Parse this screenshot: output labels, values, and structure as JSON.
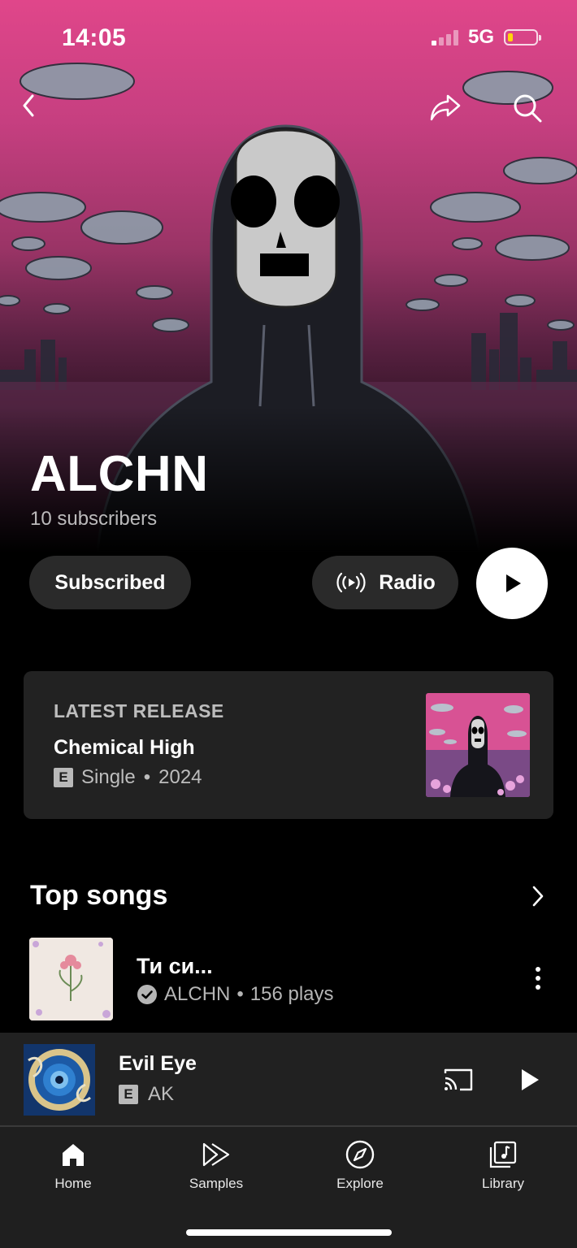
{
  "status_bar": {
    "time": "14:05",
    "network": "5G"
  },
  "artist": {
    "name": "ALCHN",
    "subscribers": "10 subscribers"
  },
  "actions": {
    "subscribe_label": "Subscribed",
    "radio_label": "Radio"
  },
  "latest_release": {
    "kicker": "LATEST RELEASE",
    "title": "Chemical High",
    "explicit_badge": "E",
    "type": "Single",
    "separator": "•",
    "year": "2024"
  },
  "top_songs": {
    "title": "Top songs",
    "items": [
      {
        "title": "Ти си...",
        "artist": "ALCHN",
        "separator": "•",
        "plays": "156 plays"
      }
    ]
  },
  "now_playing": {
    "title": "Evil Eye",
    "explicit_badge": "E",
    "artist": "AK"
  },
  "nav": {
    "items": [
      {
        "label": "Home",
        "icon": "home-icon"
      },
      {
        "label": "Samples",
        "icon": "samples-icon"
      },
      {
        "label": "Explore",
        "icon": "explore-icon"
      },
      {
        "label": "Library",
        "icon": "library-icon"
      }
    ]
  },
  "colors": {
    "hero_pink": "#e0468a",
    "background": "#000000",
    "card": "#222222",
    "battery_low": "#ffd60a"
  }
}
